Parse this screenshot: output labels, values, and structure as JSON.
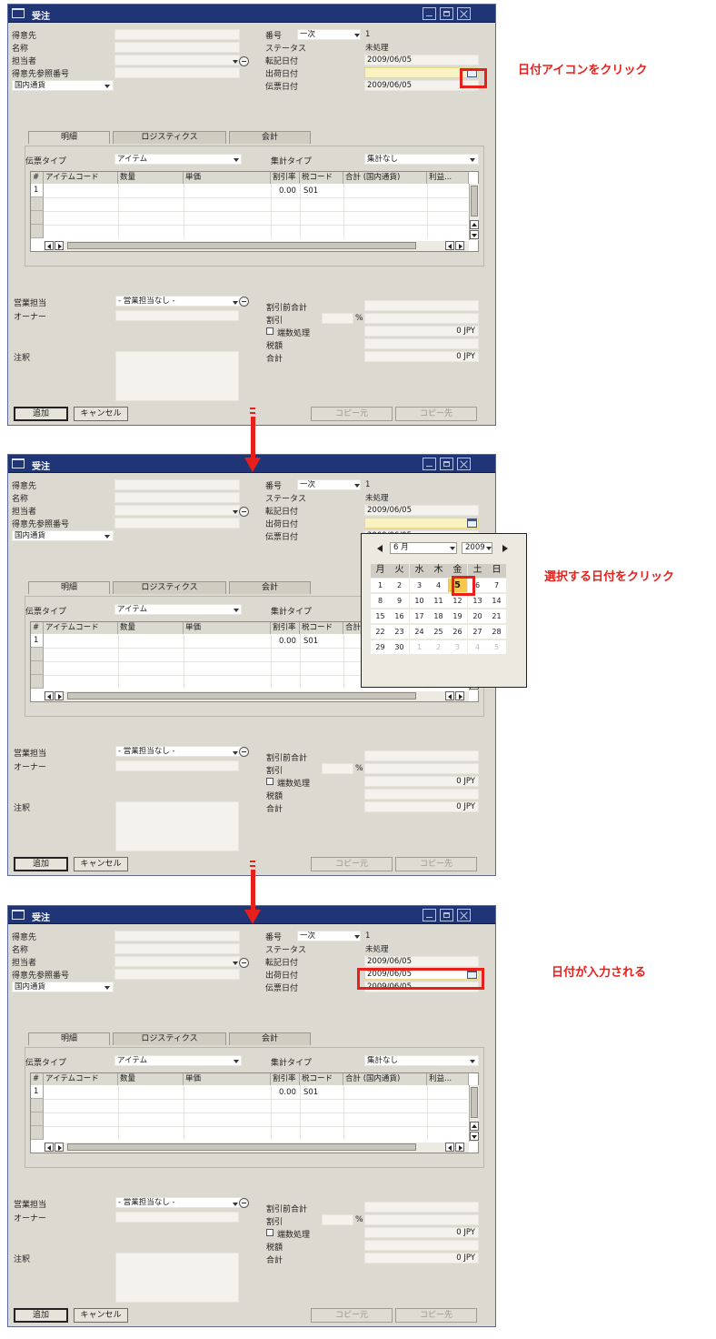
{
  "window": {
    "title": "受注",
    "fields": {
      "customer_label": "得意先",
      "name_label": "名称",
      "contact_label": "担当者",
      "customer_ref_label": "得意先参照番号",
      "currency_select": "国内通貨",
      "number_label": "番号",
      "series_value": "一次",
      "number_value": "1",
      "status_label": "ステータス",
      "status_value": "未処理",
      "posting_date_label": "転記日付",
      "posting_date_value": "2009/06/05",
      "delivery_date_label": "出荷日付",
      "document_date_label": "伝票日付",
      "document_date_value": "2009/06/05"
    },
    "tabs": [
      "明細",
      "ロジスティクス",
      "会計"
    ],
    "detail": {
      "item_type_label": "伝票タイプ",
      "item_type_value": "アイテム",
      "summary_type_label": "集計タイプ",
      "summary_type_value": "集計なし"
    },
    "grid": {
      "columns": [
        "#",
        "アイテムコード",
        "数量",
        "単価",
        "割引率",
        "税コード",
        "合計 (国内通貨)",
        "利益..."
      ],
      "row": {
        "num": "1",
        "discount": "0.00",
        "tax": "S01"
      }
    },
    "footer": {
      "sales_employee_label": "営業担当",
      "sales_employee_value": "- 営業担当なし -",
      "owner_label": "オーナー",
      "remarks_label": "注釈",
      "total_before_discount_label": "割引前合計",
      "discount_label": "割引",
      "percent": "%",
      "rounding_label": "端数処理",
      "rounding_value": "0 JPY",
      "tax_label": "税額",
      "total_label": "合計",
      "total_value": "0 JPY"
    },
    "buttons": {
      "add": "追加",
      "cancel": "キャンセル",
      "copy_from": "コピー元",
      "copy_to": "コピー先"
    }
  },
  "calendar": {
    "month": "6 月",
    "year": "2009",
    "weekdays": [
      "月",
      "火",
      "水",
      "木",
      "金",
      "土",
      "日"
    ],
    "weeks": [
      [
        "1",
        "2",
        "3",
        "4",
        "5",
        "6",
        "7"
      ],
      [
        "8",
        "9",
        "10",
        "11",
        "12",
        "13",
        "14"
      ],
      [
        "15",
        "16",
        "17",
        "18",
        "19",
        "20",
        "21"
      ],
      [
        "22",
        "23",
        "24",
        "25",
        "26",
        "27",
        "28"
      ],
      [
        "29",
        "30",
        "1",
        "2",
        "3",
        "4",
        "5"
      ]
    ],
    "selected_day": "5"
  },
  "final_delivery_date": "2009/06/05",
  "annotations": {
    "step1": "日付アイコンをクリック",
    "step2": "選択する日付をクリック",
    "step3": "日付が入力される"
  },
  "colors": {
    "title_bar": "#1f3575",
    "window_bg": "#dcdad0",
    "highlight_field": "#fbf2c2",
    "annotation": "#e8201b",
    "selected_day": "#f6c94d"
  }
}
